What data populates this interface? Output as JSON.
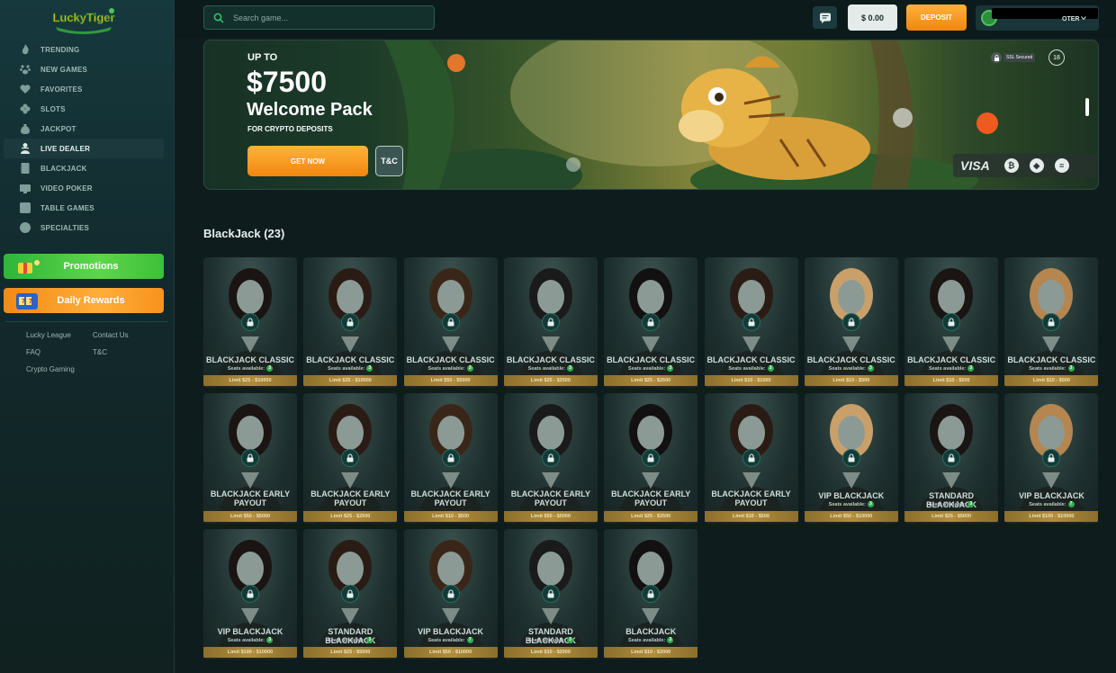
{
  "brand": {
    "logo_text": "LuckyTiger"
  },
  "sidebar": {
    "items": [
      {
        "label": "TRENDING",
        "icon": "trending-icon"
      },
      {
        "label": "NEW GAMES",
        "icon": "paw-icon"
      },
      {
        "label": "FAVORITES",
        "icon": "heart-icon"
      },
      {
        "label": "SLOTS",
        "icon": "clover-icon"
      },
      {
        "label": "JACKPOT",
        "icon": "money-bag-icon"
      },
      {
        "label": "LIVE DEALER",
        "icon": "dealer-icon",
        "active": true
      },
      {
        "label": "BLACKJACK",
        "icon": "playing-card-icon"
      },
      {
        "label": "VIDEO POKER",
        "icon": "video-poker-icon"
      },
      {
        "label": "TABLE GAMES",
        "icon": "dice-icon"
      },
      {
        "label": "SPECIALTIES",
        "icon": "gear-chip-icon"
      }
    ],
    "promotions_label": "Promotions",
    "daily_rewards_label": "Daily Rewards",
    "footer_links": {
      "lucky_league": "Lucky League",
      "contact_us": "Contact Us",
      "faq": "FAQ",
      "tc": "T&C",
      "crypto_gaming": "Crypto Gaming"
    }
  },
  "header": {
    "search_placeholder": "Search game...",
    "balance": "$ 0.00",
    "deposit_label": "DEPOSIT",
    "username": "OTER"
  },
  "banner": {
    "up_to": "UP TO",
    "amount": "$7500",
    "title": "Welcome Pack",
    "subtitle": "FOR CRYPTO DEPOSITS",
    "cta_label": "GET NOW",
    "tc_label": "T&C",
    "ssl_label": "SSL Secured",
    "age_label": "18",
    "payment_visa": "VISA",
    "payment_icons": [
      "bitcoin-icon",
      "ethereum-icon",
      "litecoin-icon"
    ]
  },
  "section": {
    "title": "BlackJack (23)"
  },
  "games": [
    {
      "name": "BLACKJACK CLASSIC",
      "seats_label": "Seats available:",
      "seats": "3",
      "limit": "Limit $25 - $10000"
    },
    {
      "name": "BLACKJACK CLASSIC",
      "seats_label": "Seats available:",
      "seats": "3",
      "limit": "Limit $25 - $10000"
    },
    {
      "name": "BLACKJACK CLASSIC",
      "seats_label": "Seats available:",
      "seats": "3",
      "limit": "Limit $50 - $5000"
    },
    {
      "name": "BLACKJACK CLASSIC",
      "seats_label": "Seats available:",
      "seats": "3",
      "limit": "Limit $25 - $2500"
    },
    {
      "name": "BLACKJACK CLASSIC",
      "seats_label": "Seats available:",
      "seats": "3",
      "limit": "Limit $25 - $2500"
    },
    {
      "name": "BLACKJACK CLASSIC",
      "seats_label": "Seats available:",
      "seats": "3",
      "limit": "Limit $10 - $1000"
    },
    {
      "name": "BLACKJACK CLASSIC",
      "seats_label": "Seats available:",
      "seats": "3",
      "limit": "Limit $10 - $500"
    },
    {
      "name": "BLACKJACK CLASSIC",
      "seats_label": "Seats available:",
      "seats": "3",
      "limit": "Limit $10 - $500"
    },
    {
      "name": "BLACKJACK CLASSIC",
      "seats_label": "Seats available:",
      "seats": "3",
      "limit": "Limit $10 - $500"
    },
    {
      "name": "BLACKJACK EARLY PAYOUT",
      "seats_label": "",
      "seats": "",
      "limit": "Limit $50 - $5000"
    },
    {
      "name": "BLACKJACK EARLY PAYOUT",
      "seats_label": "",
      "seats": "",
      "limit": "Limit $25 - $2500"
    },
    {
      "name": "BLACKJACK EARLY PAYOUT",
      "seats_label": "",
      "seats": "",
      "limit": "Limit $10 - $500"
    },
    {
      "name": "BLACKJACK EARLY PAYOUT",
      "seats_label": "",
      "seats": "",
      "limit": "Limit $50 - $5000"
    },
    {
      "name": "BLACKJACK EARLY PAYOUT",
      "seats_label": "",
      "seats": "",
      "limit": "Limit $25 - $2500"
    },
    {
      "name": "BLACKJACK EARLY PAYOUT",
      "seats_label": "",
      "seats": "",
      "limit": "Limit $10 - $500"
    },
    {
      "name": "VIP BLACKJACK",
      "seats_label": "Seats available:",
      "seats": "3",
      "limit": "Limit $50 - $10000"
    },
    {
      "name": "STANDARD BLACKJACK",
      "seats_label": "Seats available:",
      "seats": "3",
      "limit": "Limit $25 - $5000"
    },
    {
      "name": "VIP BLACKJACK",
      "seats_label": "Seats available:",
      "seats": "7",
      "limit": "Limit $100 - $10000"
    },
    {
      "name": "VIP BLACKJACK",
      "seats_label": "Seats available:",
      "seats": "3",
      "limit": "Limit $100 - $10000"
    },
    {
      "name": "STANDARD BLACKJACK",
      "seats_label": "Seats available:",
      "seats": "3",
      "limit": "Limit $25 - $5000"
    },
    {
      "name": "VIP BLACKJACK",
      "seats_label": "Seats available:",
      "seats": "7",
      "limit": "Limit $50 - $10000"
    },
    {
      "name": "STANDARD BLACKJACK",
      "seats_label": "Seats available:",
      "seats": "3",
      "limit": "Limit $10 - $2000"
    },
    {
      "name": "BLACKJACK",
      "seats_label": "Seats available:",
      "seats": "3",
      "limit": "Limit $10 - $2000"
    }
  ],
  "colors": {
    "accent_orange": "#f7941d",
    "accent_green": "#3cbf39",
    "limit_bar": "#b18d3b",
    "background": "#0f1c1d"
  }
}
